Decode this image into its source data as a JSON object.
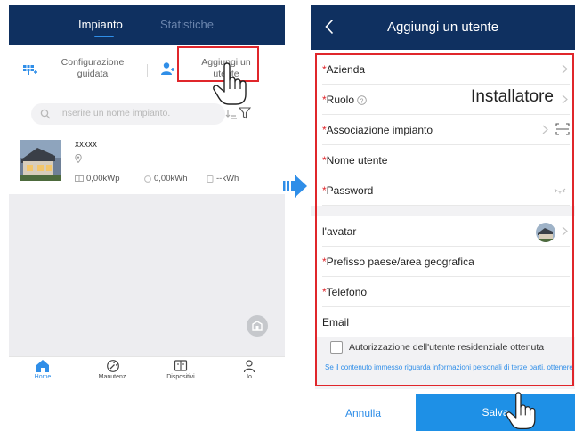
{
  "left_screen": {
    "tabs": [
      "Impianto",
      "Statistiche"
    ],
    "actions": {
      "guided_config": "Configurazione guidata",
      "add_user": "Aggiungi un utente"
    },
    "search": {
      "placeholder": "Inserire un nome impianto."
    },
    "plant": {
      "name": "xxxxx",
      "power": "0,00kWp",
      "energy": "0,00kWh",
      "total": "--kWh"
    },
    "nav": [
      "Home",
      "Manutenz.",
      "Dispositivi",
      "Io"
    ]
  },
  "right_screen": {
    "title": "Aggiungi un utente",
    "required_mark": "*",
    "fields": {
      "company": "Azienda",
      "role": "Ruolo",
      "role_value": "Installatore",
      "plant_assoc": "Associazione impianto",
      "username": "Nome utente",
      "password": "Password",
      "avatar": "l'avatar",
      "country_prefix": "Prefisso paese/area geografica",
      "phone": "Telefono",
      "email": "Email"
    },
    "consent": {
      "label": "Autorizzazione dell'utente residenziale ottenuta",
      "note": "Se il contenuto immesso riguarda informazioni personali di terze parti, ottenere l'autorizzazione in anticipo."
    },
    "buttons": {
      "cancel": "Annulla",
      "save": "Salva"
    }
  },
  "colors": {
    "header": "#0f3060",
    "accent": "#2f8ee8",
    "highlight": "#e0262b",
    "save_button": "#1e90e6"
  }
}
